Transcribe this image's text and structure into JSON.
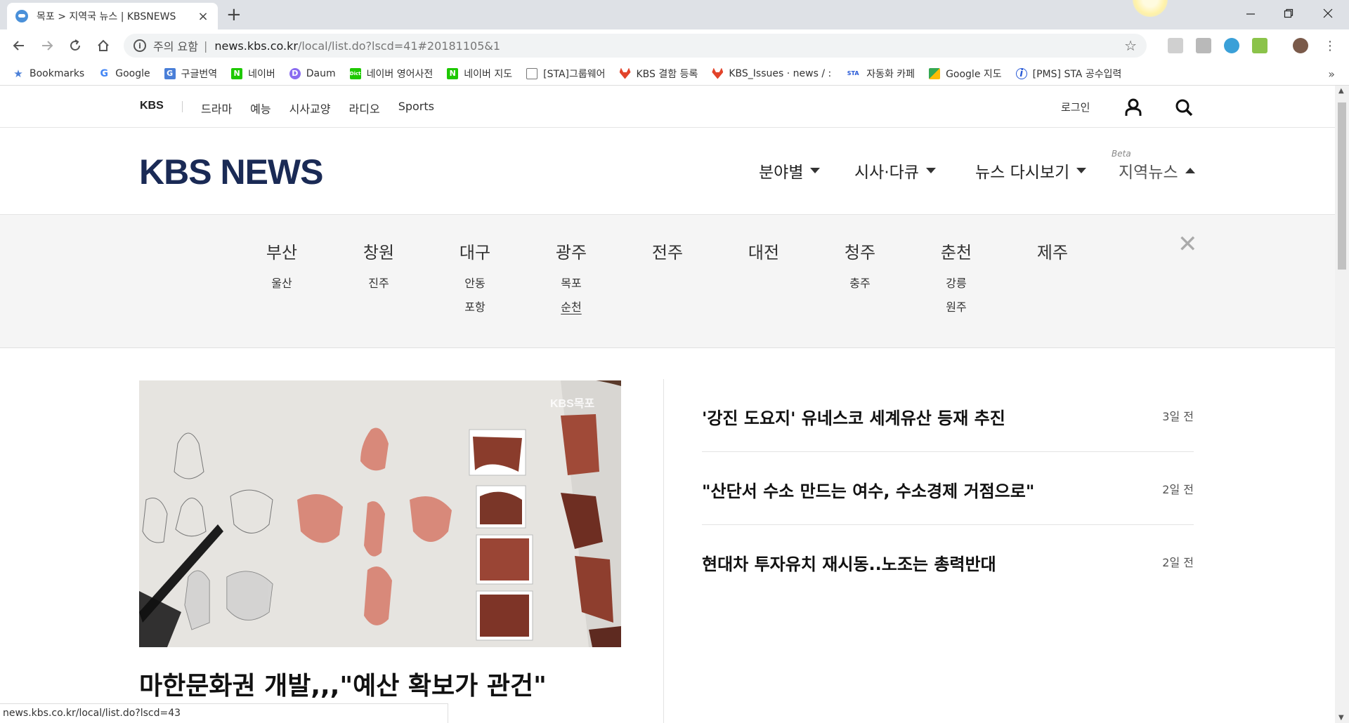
{
  "browser": {
    "tab_title": "목포 > 지역국 뉴스 | KBSNEWS",
    "tab_close": "×",
    "new_tab": "+",
    "url_warning": "주의 요함",
    "url_separator": "|",
    "url_host": "news.kbs.co.kr",
    "url_path": "/local/list.do?lscd=41#20181105&1",
    "status_url": "news.kbs.co.kr/local/list.do?lscd=43"
  },
  "bookmarks": [
    {
      "label": "Bookmarks",
      "icon": "star-icon"
    },
    {
      "label": "Google",
      "icon": "google-icon"
    },
    {
      "label": "구글번역",
      "icon": "translate-icon"
    },
    {
      "label": "네이버",
      "icon": "naver-icon"
    },
    {
      "label": "Daum",
      "icon": "daum-icon"
    },
    {
      "label": "네이버 영어사전",
      "icon": "dict-icon"
    },
    {
      "label": "네이버 지도",
      "icon": "naver-map-icon"
    },
    {
      "label": "[STA]그룹웨어",
      "icon": "page-icon"
    },
    {
      "label": "KBS 결함 등록",
      "icon": "gitlab-icon"
    },
    {
      "label": "KBS_Issues · news / :",
      "icon": "gitlab-icon"
    },
    {
      "label": "자동화 카페",
      "icon": "cafe-icon"
    },
    {
      "label": "Google 지도",
      "icon": "maps-icon"
    },
    {
      "label": "[PMS] STA 공수입력",
      "icon": "pms-icon"
    }
  ],
  "util": {
    "brand": "KBS",
    "links": [
      "드라마",
      "예능",
      "시사교양",
      "라디오",
      "Sports"
    ],
    "login": "로그인"
  },
  "nav": {
    "logo": "KBS NEWS",
    "menus": [
      "분야별",
      "시사·다큐",
      "뉴스 다시보기",
      "지역뉴스"
    ],
    "beta": "Beta"
  },
  "regions": [
    {
      "main": "부산",
      "subs": [
        "울산"
      ]
    },
    {
      "main": "창원",
      "subs": [
        "진주"
      ]
    },
    {
      "main": "대구",
      "subs": [
        "안동",
        "포항"
      ]
    },
    {
      "main": "광주",
      "subs": [
        "목포",
        "순천"
      ]
    },
    {
      "main": "전주",
      "subs": []
    },
    {
      "main": "대전",
      "subs": []
    },
    {
      "main": "청주",
      "subs": [
        "충주"
      ]
    },
    {
      "main": "춘천",
      "subs": [
        "강릉",
        "원주"
      ]
    },
    {
      "main": "제주",
      "subs": []
    }
  ],
  "regions_close": "✕",
  "feature": {
    "watermark": "KBS목포",
    "headline": "마한문화권 개발,,,\"예산 확보가 관건\""
  },
  "news": [
    {
      "title": "'강진 도요지' 유네스코 세계유산 등재 추진",
      "date": "3일 전"
    },
    {
      "title": "\"산단서 수소 만드는 여수, 수소경제 거점으로\"",
      "date": "2일 전"
    },
    {
      "title": "현대차 투자유치 재시동..노조는 총력반대",
      "date": "2일 전"
    }
  ],
  "colors": {
    "logo": "#1a2a55",
    "region_bg": "#f5f5f5"
  }
}
